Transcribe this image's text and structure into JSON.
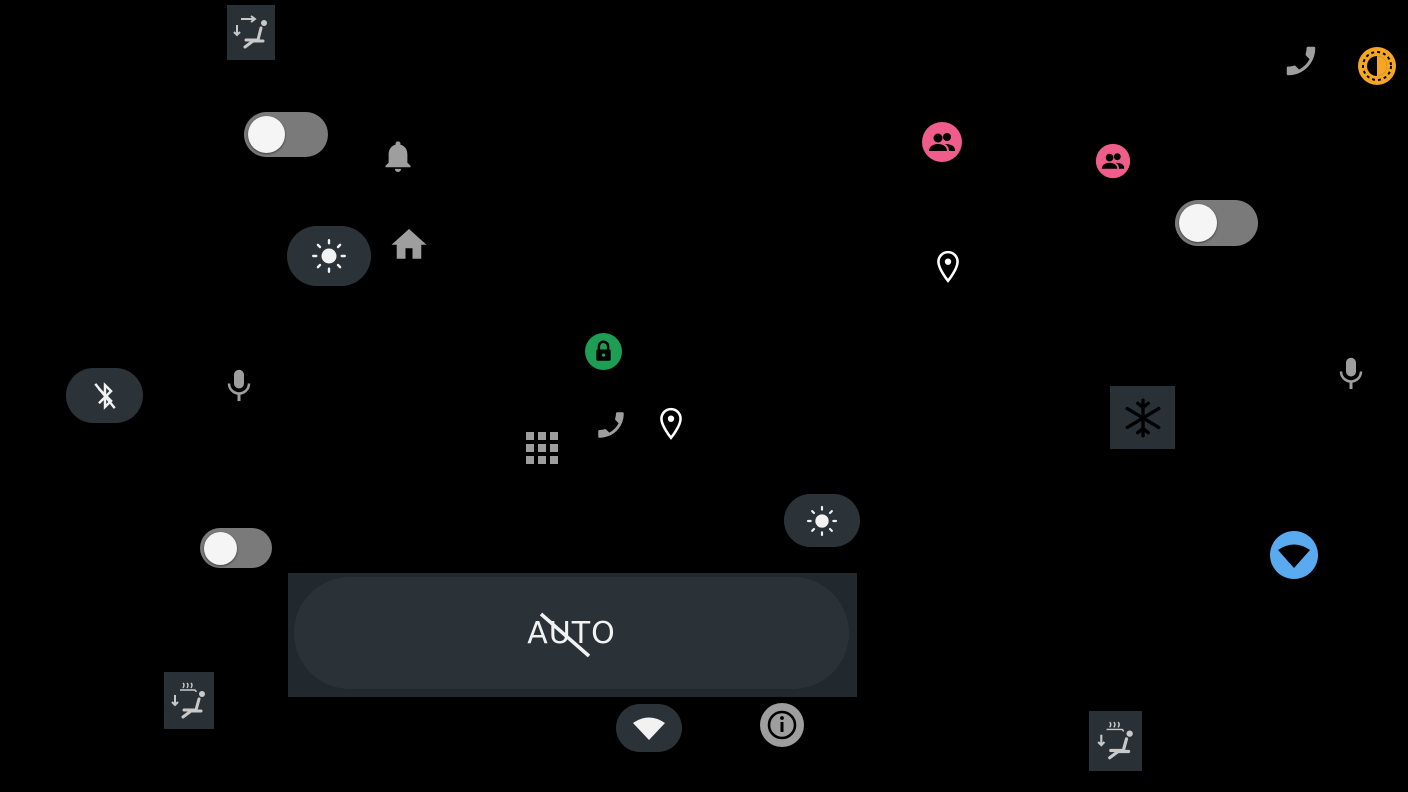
{
  "colors": {
    "background": "#000000",
    "pill_background": "#2c3338",
    "toggle_track": "#7a7a7a",
    "toggle_knob": "#f5f5f5",
    "icon_gray": "#9e9e9e",
    "pink_accent": "#ef5d8a",
    "green_lock": "#1e9e55",
    "orange_brightness": "#f5a623",
    "blue_wifi": "#5aaaf0",
    "square_tile": "#2a3136"
  },
  "icons": [
    "seat-airflow-icon",
    "phone-icon",
    "auto-brightness-icon",
    "bell-icon",
    "home-icon",
    "brightness-icon",
    "people-icon",
    "location-pin-icon",
    "lock-icon",
    "bluetooth-off-icon",
    "microphone-icon",
    "app-grid-icon",
    "snowflake-icon",
    "wifi-icon",
    "info-icon",
    "seat-heat-icon"
  ],
  "toggles": [
    {
      "id": "toggle-1",
      "state": "off"
    },
    {
      "id": "toggle-2",
      "state": "off"
    },
    {
      "id": "toggle-3",
      "state": "off"
    }
  ],
  "auto_panel": {
    "label": "AUTO",
    "state": "disabled"
  }
}
